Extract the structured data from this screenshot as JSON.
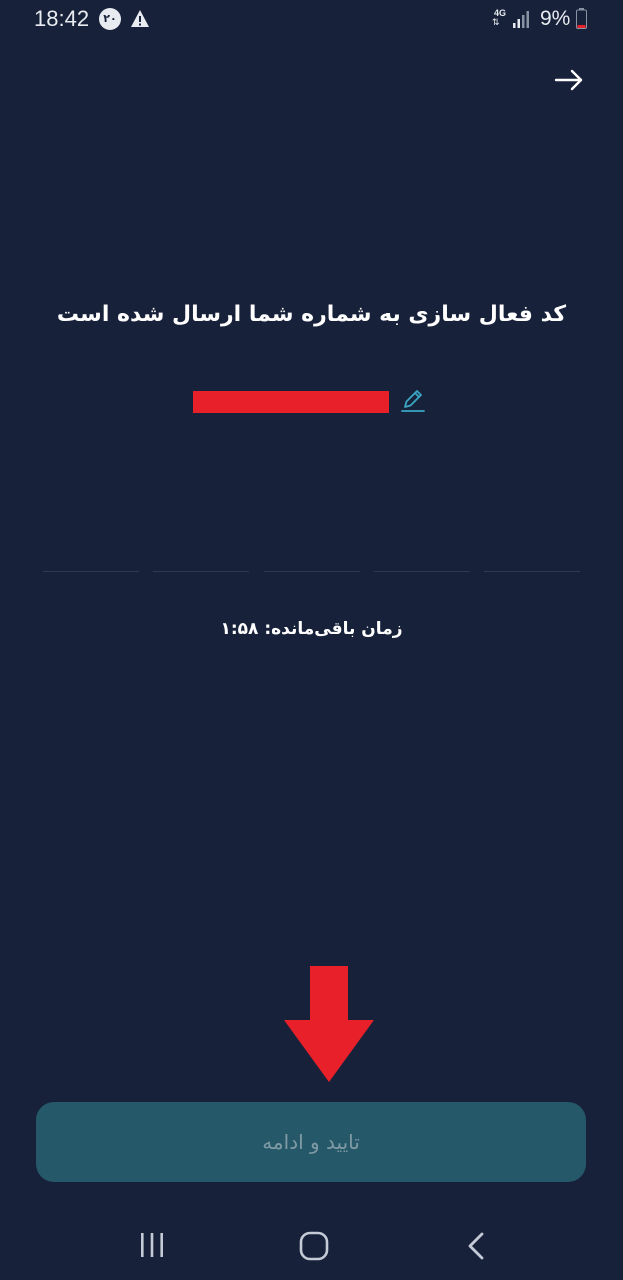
{
  "status_bar": {
    "time": "18:42",
    "notification_badge": "۲۰",
    "network_type": "4G",
    "network_arrows": "⇅",
    "battery_percent": "9%"
  },
  "header": {
    "back_icon": "arrow-right-icon"
  },
  "main": {
    "heading": "کد فعال سازی به شماره شما ارسال شده است",
    "phone_number_redacted": true,
    "edit_icon": "pencil-icon",
    "otp_length": 5,
    "timer_label": "زمان باقی‌مانده: ۱:۵۸"
  },
  "footer": {
    "confirm_label": "تایید و ادامه"
  },
  "nav_bar": {
    "recents_icon": "recents-icon",
    "home_icon": "home-icon",
    "back_icon": "chevron-left-icon"
  },
  "colors": {
    "background": "#17223a",
    "button_bg": "#255868",
    "button_text": "#7f9aa5",
    "accent_edit": "#3aa6c5",
    "redaction": "#e8202a",
    "otp_line": "#2d3a52"
  }
}
